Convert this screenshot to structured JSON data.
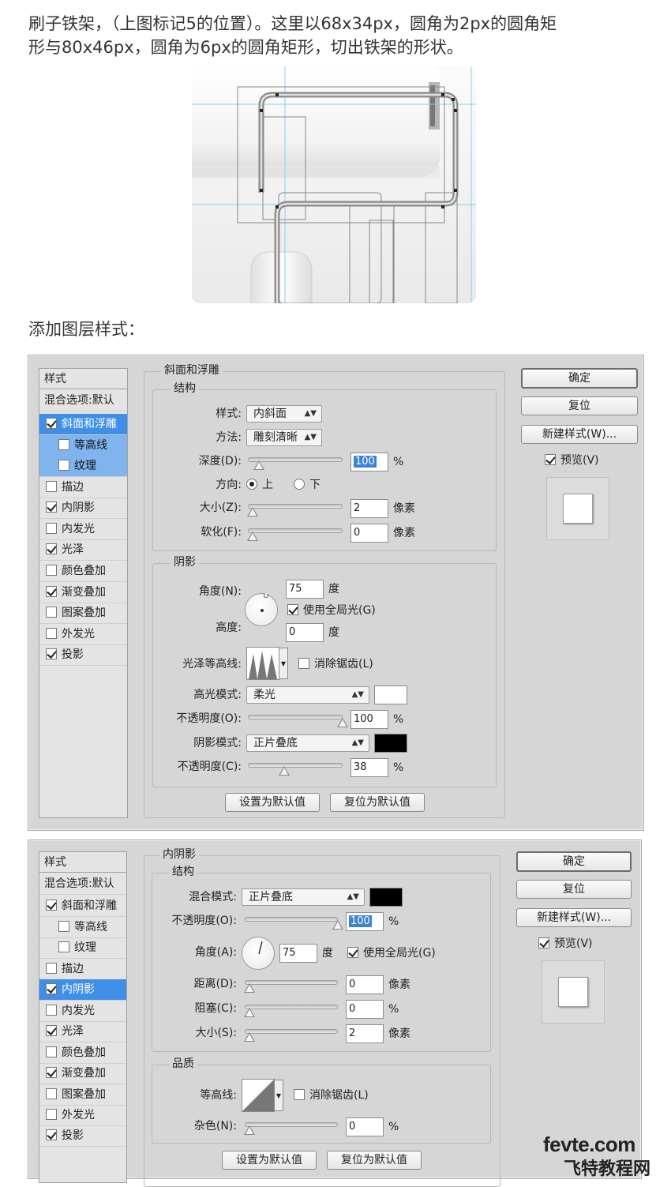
{
  "intro": {
    "line1": "刷子铁架，（上图标记5的位置）。这里以68x34px，圆角为2px的圆角矩",
    "line2": "形与80x46px，圆角为6px的圆角矩形，切出铁架的形状。"
  },
  "section_heading": "添加图层样式：",
  "dialog1": {
    "panel_title": "样式",
    "blend_options": "混合选项:默认",
    "items": [
      {
        "label": "斜面和浮雕",
        "checked": true
      },
      {
        "label": "等高线",
        "checked": false
      },
      {
        "label": "纹理",
        "checked": false
      },
      {
        "label": "描边",
        "checked": false
      },
      {
        "label": "内阴影",
        "checked": true
      },
      {
        "label": "内发光",
        "checked": false
      },
      {
        "label": "光泽",
        "checked": true
      },
      {
        "label": "颜色叠加",
        "checked": false
      },
      {
        "label": "渐变叠加",
        "checked": true
      },
      {
        "label": "图案叠加",
        "checked": false
      },
      {
        "label": "外发光",
        "checked": false
      },
      {
        "label": "投影",
        "checked": true
      }
    ],
    "section_title": "斜面和浮雕",
    "structure_title": "结构",
    "style_label": "样式:",
    "style_value": "内斜面",
    "technique_label": "方法:",
    "technique_value": "雕刻清晰",
    "depth_label": "深度(D):",
    "depth_value": "100",
    "percent": "%",
    "direction_label": "方向:",
    "direction_up": "上",
    "direction_down": "下",
    "size_label": "大小(Z):",
    "size_value": "2",
    "pixel_unit": "像素",
    "soften_label": "软化(F):",
    "soften_value": "0",
    "shading_title": "阴影",
    "angle_label": "角度(N):",
    "angle_value": "75",
    "degree_unit": "度",
    "global_light": "使用全局光(G)",
    "altitude_label": "高度:",
    "altitude_value": "0",
    "gloss_contour_label": "光泽等高线:",
    "anti_alias": "消除锯齿(L)",
    "highlight_mode_label": "高光模式:",
    "highlight_mode_value": "柔光",
    "highlight_opacity_label": "不透明度(O):",
    "highlight_opacity_value": "100",
    "shadow_mode_label": "阴影模式:",
    "shadow_mode_value": "正片叠底",
    "shadow_opacity_label": "不透明度(C):",
    "shadow_opacity_value": "38",
    "make_default": "设置为默认值",
    "reset_default": "复位为默认值",
    "ok": "确定",
    "reset": "复位",
    "new_style": "新建样式(W)...",
    "preview": "预览(V)",
    "highlight_color": "#ffffff",
    "shadow_color": "#000000"
  },
  "dialog2": {
    "panel_title": "样式",
    "blend_options": "混合选项:默认",
    "items": [
      {
        "label": "斜面和浮雕",
        "checked": true
      },
      {
        "label": "等高线",
        "checked": false
      },
      {
        "label": "纹理",
        "checked": false
      },
      {
        "label": "描边",
        "checked": false
      },
      {
        "label": "内阴影",
        "checked": true
      },
      {
        "label": "内发光",
        "checked": false
      },
      {
        "label": "光泽",
        "checked": true
      },
      {
        "label": "颜色叠加",
        "checked": false
      },
      {
        "label": "渐变叠加",
        "checked": true
      },
      {
        "label": "图案叠加",
        "checked": false
      },
      {
        "label": "外发光",
        "checked": false
      },
      {
        "label": "投影",
        "checked": true
      }
    ],
    "section_title": "内阴影",
    "structure_title": "结构",
    "blend_mode_label": "混合模式:",
    "blend_mode_value": "正片叠底",
    "opacity_label": "不透明度(O):",
    "opacity_value": "100",
    "percent": "%",
    "angle_label": "角度(A):",
    "angle_value": "75",
    "degree_unit": "度",
    "global_light": "使用全局光(G)",
    "distance_label": "距离(D):",
    "distance_value": "0",
    "pixel_unit": "像素",
    "choke_label": "阻塞(C):",
    "choke_value": "0",
    "size_label": "大小(S):",
    "size_value": "2",
    "quality_title": "品质",
    "contour_label": "等高线:",
    "anti_alias": "消除锯齿(L)",
    "noise_label": "杂色(N):",
    "noise_value": "0",
    "make_default": "设置为默认值",
    "reset_default": "复位为默认值",
    "ok": "确定",
    "reset": "复位",
    "new_style": "新建样式(W)...",
    "preview": "预览(V)",
    "shadow_color": "#000000"
  },
  "watermark": {
    "site": "fevte.com",
    "name": "飞特教程网"
  }
}
